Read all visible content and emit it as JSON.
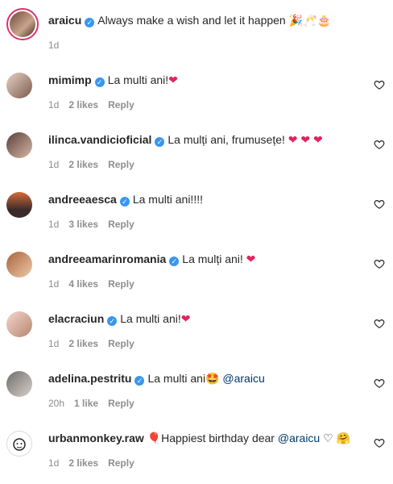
{
  "caption": {
    "username": "araicu",
    "text": "Always make a wish and let it happen",
    "emojis": "🎉🥂🎂",
    "time": "1d"
  },
  "comments": [
    {
      "username": "mimimp",
      "verified": true,
      "text": "La multi ani!",
      "suffix": "❤",
      "time": "1d",
      "likes": "2 likes",
      "reply": "Reply"
    },
    {
      "username": "ilinca.vandicioficial",
      "verified": true,
      "text": "La mulți ani, frumusețe!",
      "suffix": "❤ ❤ ❤",
      "time": "1d",
      "likes": "2 likes",
      "reply": "Reply"
    },
    {
      "username": "andreeaesca",
      "verified": true,
      "text": "La multi ani!!!!",
      "suffix": "",
      "time": "1d",
      "likes": "3 likes",
      "reply": "Reply"
    },
    {
      "username": "andreeamarinromania",
      "verified": true,
      "text": "La mulți ani!",
      "suffix": "❤",
      "time": "1d",
      "likes": "4 likes",
      "reply": "Reply"
    },
    {
      "username": "elacraciun",
      "verified": true,
      "text": "La multi ani!",
      "suffix": "❤",
      "time": "1d",
      "likes": "2 likes",
      "reply": "Reply"
    },
    {
      "username": "adelina.pestritu",
      "verified": true,
      "text": "La multi ani",
      "suffix": "🤩",
      "mention": "@araicu",
      "time": "20h",
      "likes": "1 like",
      "reply": "Reply"
    },
    {
      "username": "urbanmonkey.raw",
      "verified": false,
      "prefix": "🎈",
      "text": "Happiest birthday dear",
      "mention": "@araicu",
      "suffix": "♡ 🤗",
      "time": "1d",
      "likes": "2 likes",
      "reply": "Reply"
    }
  ],
  "colors": {
    "text": "#262626",
    "secondary": "#8e8e8e",
    "verified": "#3897f0",
    "heart": "#e0245e",
    "mention": "#00376b"
  },
  "icons": {
    "verified": "verified-badge-icon",
    "like": "heart-outline-icon"
  }
}
